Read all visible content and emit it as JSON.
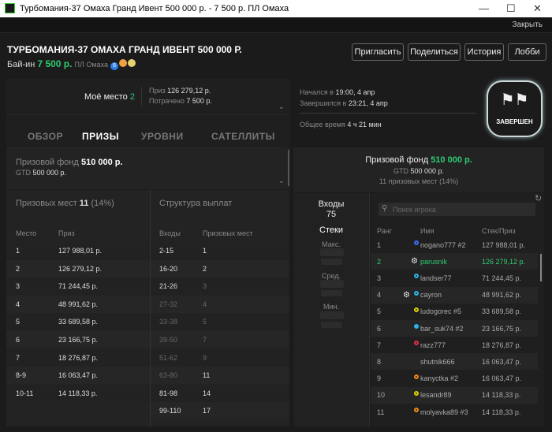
{
  "window": {
    "title": "Турбомания-37 Омаха Гранд Ивент 500 000 р. - 7 500 р. ПЛ Омаха",
    "minimize": "—",
    "maximize": "☐",
    "close": "✕"
  },
  "closebar": {
    "close_label": "Закрыть"
  },
  "header": {
    "title": "ТУРБОМАНИЯ-37 ОМАХА ГРАНД ИВЕНТ 500 000 Р.",
    "buyin_label": "Бай-ин",
    "buyin_value": "7 500 р.",
    "game": "ПЛ Омаха",
    "badges": [
      "6",
      "⚙",
      "BJ"
    ],
    "buttons": {
      "invite": "Пригласить",
      "share": "Поделиться",
      "history": "История",
      "lobby": "Лобби"
    }
  },
  "my": {
    "place_label": "Моё место",
    "place_value": "2",
    "prize_label": "Приз",
    "prize_value": "126 279,12 р.",
    "spent_label": "Потрачено",
    "spent_value": "7 500 р."
  },
  "tabs": [
    "ОБЗОР",
    "ПРИЗЫ",
    "УРОВНИ",
    "САТЕЛЛИТЫ"
  ],
  "prizepool": {
    "label": "Призовой фонд",
    "value": "510 000 р.",
    "gtd_label": "GTD",
    "gtd_value": "500 000 р.",
    "places_text": "11 призовых мест (14%)"
  },
  "places": {
    "label": "Призовых мест",
    "value": "11",
    "pct": "(14%)",
    "col_place": "Место",
    "col_prize": "Приз",
    "rows": [
      [
        "1",
        "127 988,01 р."
      ],
      [
        "2",
        "126 279,12 р."
      ],
      [
        "3",
        "71 244,45 р."
      ],
      [
        "4",
        "48 991,62 р."
      ],
      [
        "5",
        "33 689,58 р."
      ],
      [
        "6",
        "23 166,75 р."
      ],
      [
        "7",
        "18 276,87 р."
      ],
      [
        "8-9",
        "16 063,47 р."
      ],
      [
        "10-11",
        "14 118,33 р."
      ]
    ]
  },
  "structure": {
    "label": "Структура выплат",
    "col_entries": "Входы",
    "col_places": "Призовых мест",
    "rows": [
      [
        "2-15",
        "1",
        false,
        false
      ],
      [
        "16-20",
        "2",
        false,
        false
      ],
      [
        "21-26",
        "3",
        false,
        true
      ],
      [
        "27-32",
        "4",
        true,
        true
      ],
      [
        "33-38",
        "5",
        true,
        true
      ],
      [
        "39-50",
        "7",
        true,
        true
      ],
      [
        "51-62",
        "9",
        true,
        true
      ],
      [
        "63-80",
        "11",
        true,
        false
      ],
      [
        "81-98",
        "14",
        false,
        false
      ],
      [
        "99-110",
        "17",
        false,
        false
      ]
    ]
  },
  "times": {
    "started_label": "Начался в",
    "started": "19:00, 4 апр",
    "ended_label": "Завершился в",
    "ended": "23:21, 4 апр",
    "total_label": "Общее время",
    "total": "4 ч 21 мин"
  },
  "status": {
    "label": "ЗАВЕРШЕН"
  },
  "entries": {
    "label": "Входы",
    "value": "75",
    "stacks_label": "Стеки",
    "max": "Макс.",
    "avg": "Сред.",
    "min": "Мин."
  },
  "players": {
    "search_placeholder": "Поиск игрока",
    "col_rank": "Ранг",
    "col_name": "Имя",
    "col_stack": "Стек/Приз",
    "rows": [
      {
        "rank": "1",
        "name": "nogano777 #2",
        "prize": "127 988,01 р.",
        "dot": "#3a6df0",
        "gear": false
      },
      {
        "rank": "2",
        "name": "parusnik",
        "prize": "126 279,12 р.",
        "dot": "",
        "gear": true,
        "me": true
      },
      {
        "rank": "3",
        "name": "landser77",
        "prize": "71 244,45 р.",
        "dot": "#2bb5e8",
        "gear": false
      },
      {
        "rank": "4",
        "name": "cayron",
        "prize": "48 991,62 р.",
        "dot": "#2bb5e8",
        "gear": true
      },
      {
        "rank": "5",
        "name": "ludogorec #5",
        "prize": "33 689,58 р.",
        "dot": "#e0d000",
        "gear": false
      },
      {
        "rank": "6",
        "name": "bar_suk74 #2",
        "prize": "23 166,75 р.",
        "dot": "#2bb5e8",
        "gear": false,
        "filled": true
      },
      {
        "rank": "7",
        "name": "razz777",
        "prize": "18 276,87 р.",
        "dot": "#e0304a",
        "gear": false
      },
      {
        "rank": "8",
        "name": "shutnik666",
        "prize": "16 063,47 р.",
        "dot": "",
        "gear": false
      },
      {
        "rank": "9",
        "name": "kanyctka #2",
        "prize": "16 063,47 р.",
        "dot": "#f08a10",
        "gear": false
      },
      {
        "rank": "10",
        "name": "lesandr89",
        "prize": "14 118,33 р.",
        "dot": "#e0d000",
        "gear": false
      },
      {
        "rank": "11",
        "name": "molyavka89 #3",
        "prize": "14 118,33 р.",
        "dot": "#f08a10",
        "gear": false
      }
    ]
  }
}
